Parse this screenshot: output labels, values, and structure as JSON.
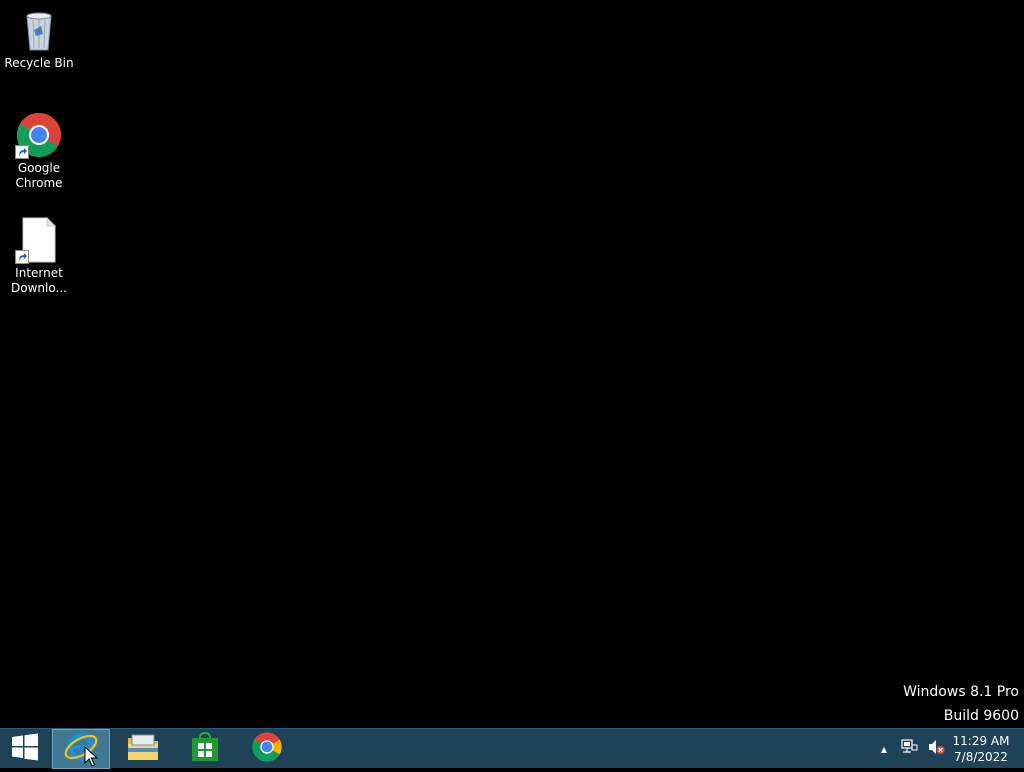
{
  "desktop": {
    "icons": [
      {
        "label": "Recycle Bin",
        "icon": "recycle-bin-icon"
      },
      {
        "label": "Google\nChrome",
        "icon": "chrome-icon",
        "shortcut": true
      },
      {
        "label": "Internet\nDownlo...",
        "icon": "blank-file-icon",
        "shortcut": true
      }
    ]
  },
  "watermark": {
    "line1": "Windows 8.1 Pro",
    "line2": "Build 9600"
  },
  "taskbar": {
    "start": {
      "icon": "windows-logo-icon"
    },
    "pinned": [
      {
        "name": "internet-explorer",
        "icon": "internet-explorer-icon",
        "active": true
      },
      {
        "name": "file-explorer",
        "icon": "folder-icon",
        "active": false
      },
      {
        "name": "store",
        "icon": "store-icon",
        "active": false
      },
      {
        "name": "chrome",
        "icon": "chrome-icon",
        "active": false
      }
    ],
    "tray": {
      "show_hidden": "▲",
      "network_icon": "network-icon",
      "volume_icon": "volume-muted-icon",
      "time": "11:29 AM",
      "date": "7/8/2022"
    }
  },
  "colors": {
    "desktop_bg": "#000000",
    "taskbar_bg": "#1e4257",
    "active_btn_bg": "#3f7994"
  }
}
